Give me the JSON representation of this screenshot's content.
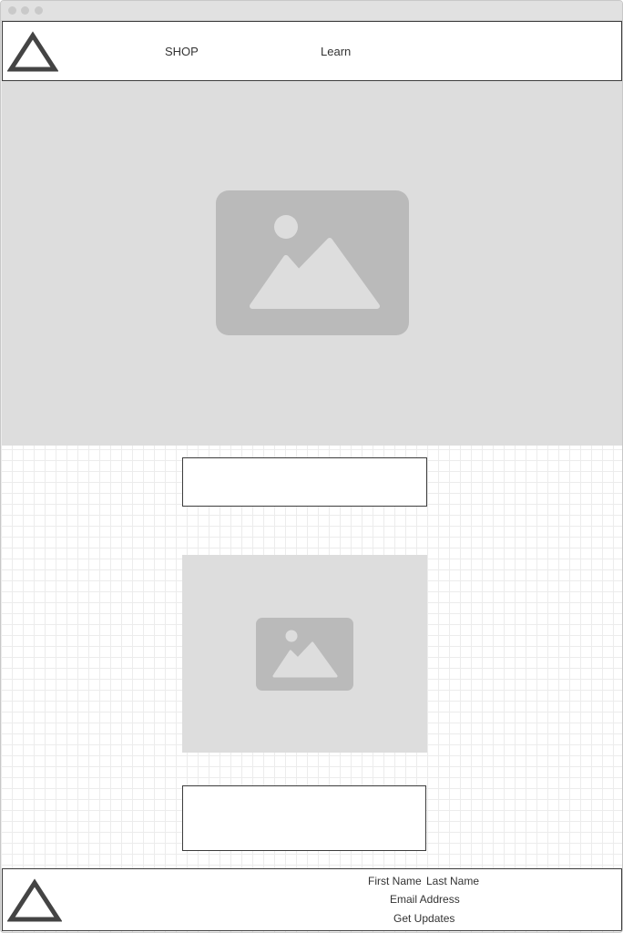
{
  "nav": {
    "items": [
      {
        "label": "SHOP"
      },
      {
        "label": "Learn"
      }
    ]
  },
  "footer": {
    "first_name_label": "First Name",
    "last_name_label": "Last Name",
    "email_label": "Email Address",
    "submit_label": "Get Updates"
  },
  "icons": {
    "logo": "triangle-logo-icon",
    "image_placeholder": "image-placeholder-icon",
    "window_controls": "window-control-dot-icon"
  },
  "colors": {
    "placeholder_background": "#dddddd",
    "placeholder_icon": "#bababa",
    "border": "#3c3c3c",
    "logo": "#444444",
    "text": "#333333"
  }
}
